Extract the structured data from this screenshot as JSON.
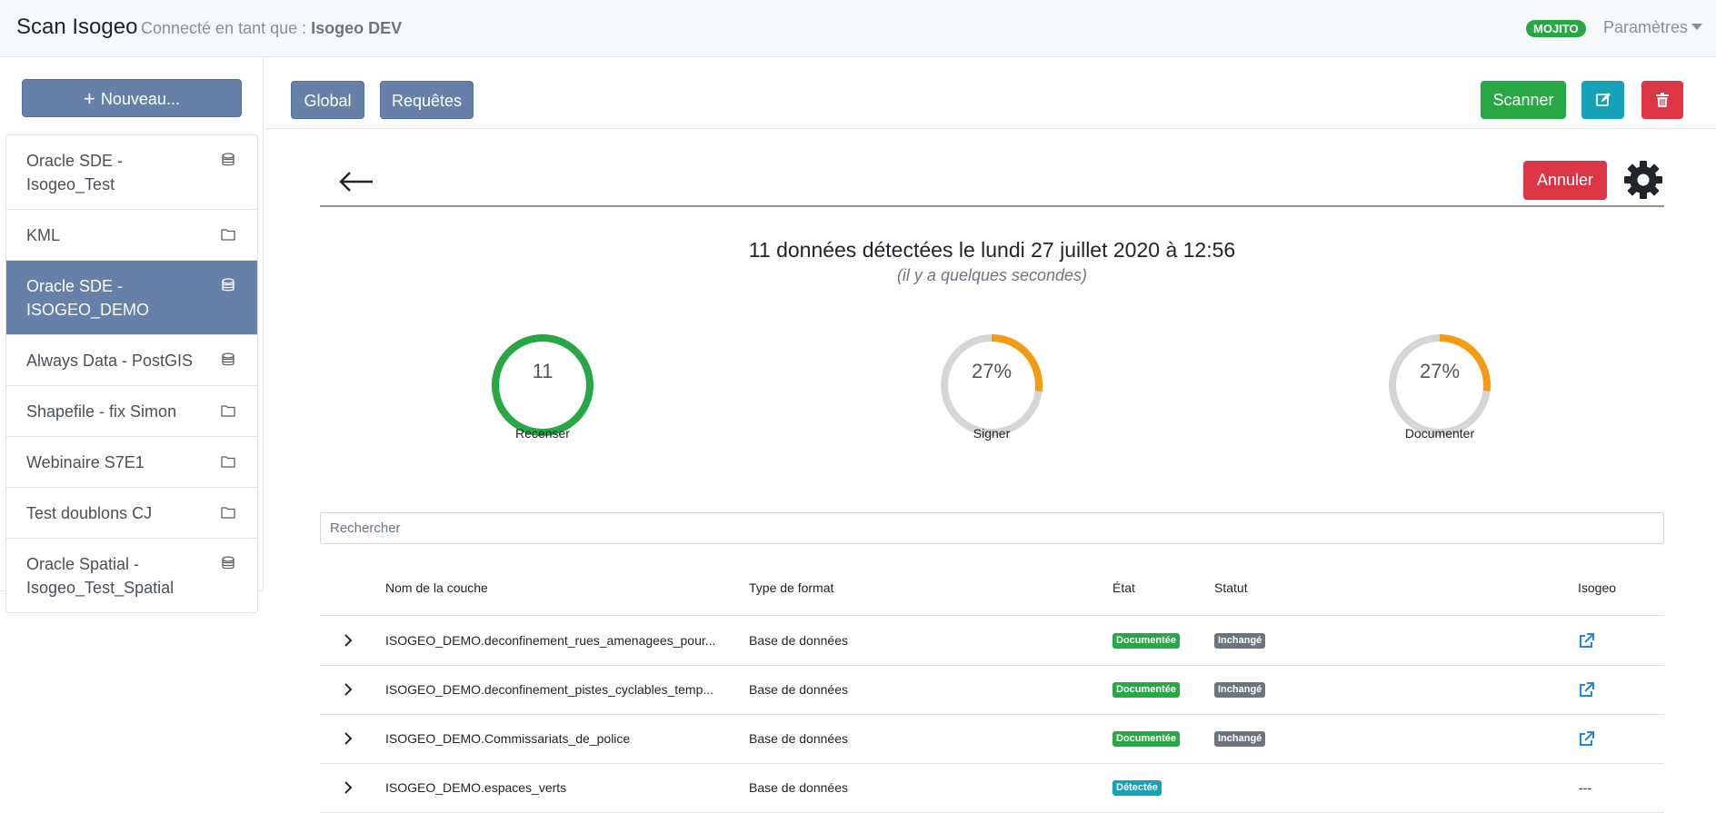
{
  "navbar": {
    "brand": "Scan Isogeo",
    "connected_prefix": "Connecté en tant que :",
    "connected_user": "Isogeo DEV",
    "env_badge": "MOJITO",
    "settings_label": "Paramètres"
  },
  "sidebar": {
    "new_button": "Nouveau...",
    "new_icon": "plus-icon",
    "items": [
      {
        "label": "Oracle SDE - Isogeo_Test",
        "icon": "database-icon",
        "active": false
      },
      {
        "label": "KML",
        "icon": "folder-icon",
        "active": false
      },
      {
        "label": "Oracle SDE - ISOGEO_DEMO",
        "icon": "database-icon",
        "active": true
      },
      {
        "label": "Always Data - PostGIS",
        "icon": "database-icon",
        "active": false
      },
      {
        "label": "Shapefile - fix Simon",
        "icon": "folder-icon",
        "active": false
      },
      {
        "label": "Webinaire S7E1",
        "icon": "folder-icon",
        "active": false
      },
      {
        "label": "Test doublons CJ",
        "icon": "folder-icon",
        "active": false
      },
      {
        "label": "Oracle Spatial - Isogeo_Test_Spatial",
        "icon": "database-icon",
        "active": false
      }
    ]
  },
  "toolbar": {
    "global_label": "Global",
    "requetes_label": "Requêtes",
    "scanner_label": "Scanner",
    "edit_icon": "edit-icon",
    "delete_icon": "trash-icon"
  },
  "scan": {
    "cancel_label": "Annuler",
    "title": "11 données détectées le lundi 27 juillet 2020 à 12:56",
    "subtitle": "(il y a quelques secondes)"
  },
  "gauges": [
    {
      "value_text": "11",
      "label": "Recenser",
      "fraction": 1.0,
      "color": "#28a745"
    },
    {
      "value_text": "27%",
      "label": "Signer",
      "fraction": 0.27,
      "color": "#f39c12"
    },
    {
      "value_text": "27%",
      "label": "Documenter",
      "fraction": 0.27,
      "color": "#f39c12"
    }
  ],
  "search": {
    "placeholder": "Rechercher"
  },
  "table": {
    "headers": {
      "name": "Nom de la couche",
      "format": "Type de format",
      "etat": "État",
      "statut": "Statut",
      "isogeo": "Isogeo"
    },
    "rows": [
      {
        "name": "ISOGEO_DEMO.deconfinement_rues_amenagees_pour...",
        "format": "Base de données",
        "etat": "Documentée",
        "etat_type": "doc",
        "statut": "Inchangé",
        "isogeo": "link"
      },
      {
        "name": "ISOGEO_DEMO.deconfinement_pistes_cyclables_temp...",
        "format": "Base de données",
        "etat": "Documentée",
        "etat_type": "doc",
        "statut": "Inchangé",
        "isogeo": "link"
      },
      {
        "name": "ISOGEO_DEMO.Commissariats_de_police",
        "format": "Base de données",
        "etat": "Documentée",
        "etat_type": "doc",
        "statut": "Inchangé",
        "isogeo": "link"
      },
      {
        "name": "ISOGEO_DEMO.espaces_verts",
        "format": "Base de données",
        "etat": "Détectée",
        "etat_type": "det",
        "statut": "",
        "isogeo": "---"
      }
    ]
  }
}
